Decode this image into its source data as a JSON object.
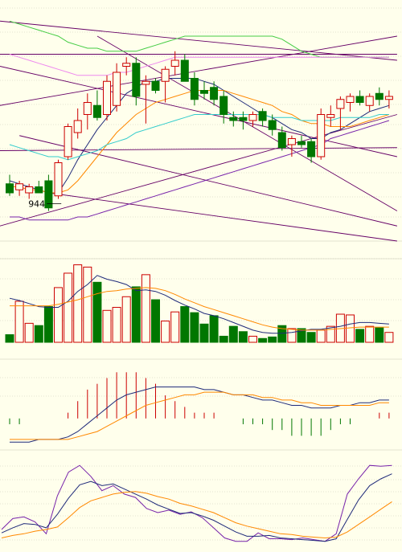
{
  "colors": {
    "background": "#ffffec",
    "grid": "#c8c8b4",
    "up": "#cc0000",
    "down": "#007700",
    "ma_short": "#1f2a7a",
    "ma_mid": "#ff8800",
    "ma_long": "#33cccc",
    "ma_xlong": "#7722aa",
    "boll_upper": "#44cc44",
    "pink": "#ee88ee",
    "channel": "#660066"
  },
  "chart_data": [
    {
      "type": "candlestick",
      "panel": "price",
      "annotation": {
        "text": "944",
        "bar_index": 2
      },
      "ylim": [
        930,
        1010
      ],
      "x": [
        0,
        1,
        2,
        3,
        4,
        5,
        6,
        7,
        8,
        9,
        10,
        11,
        12,
        13,
        14,
        15,
        16,
        17,
        18,
        19,
        20,
        21,
        22,
        23,
        24,
        25,
        26,
        27,
        28,
        29,
        30,
        31,
        32,
        33,
        34,
        35,
        36,
        37,
        38,
        39
      ],
      "candles": [
        {
          "o": 949,
          "h": 952,
          "l": 945,
          "c": 946
        },
        {
          "o": 947,
          "h": 950,
          "l": 945,
          "c": 949
        },
        {
          "o": 946,
          "h": 949,
          "l": 944,
          "c": 948
        },
        {
          "o": 948,
          "h": 950,
          "l": 946,
          "c": 946
        },
        {
          "o": 950,
          "h": 952,
          "l": 940,
          "c": 941
        },
        {
          "o": 945,
          "h": 957,
          "l": 944,
          "c": 956
        },
        {
          "o": 958,
          "h": 969,
          "l": 957,
          "c": 968
        },
        {
          "o": 966,
          "h": 974,
          "l": 964,
          "c": 970
        },
        {
          "o": 972,
          "h": 979,
          "l": 967,
          "c": 976
        },
        {
          "o": 975,
          "h": 980,
          "l": 970,
          "c": 971
        },
        {
          "o": 972,
          "h": 985,
          "l": 970,
          "c": 983
        },
        {
          "o": 975,
          "h": 989,
          "l": 973,
          "c": 986
        },
        {
          "o": 988,
          "h": 991,
          "l": 985,
          "c": 989
        },
        {
          "o": 989,
          "h": 991,
          "l": 975,
          "c": 978
        },
        {
          "o": 982,
          "h": 985,
          "l": 969,
          "c": 983
        },
        {
          "o": 983,
          "h": 984,
          "l": 979,
          "c": 980
        },
        {
          "o": 983,
          "h": 988,
          "l": 976,
          "c": 987
        },
        {
          "o": 988,
          "h": 993,
          "l": 985,
          "c": 990
        },
        {
          "o": 990,
          "h": 992,
          "l": 984,
          "c": 983
        },
        {
          "o": 984,
          "h": 986,
          "l": 975,
          "c": 977
        },
        {
          "o": 980,
          "h": 983,
          "l": 977,
          "c": 979
        },
        {
          "o": 981,
          "h": 983,
          "l": 975,
          "c": 977
        },
        {
          "o": 978,
          "h": 980,
          "l": 969,
          "c": 972
        },
        {
          "o": 971,
          "h": 973,
          "l": 968,
          "c": 970
        },
        {
          "o": 971,
          "h": 973,
          "l": 967,
          "c": 970
        },
        {
          "o": 970,
          "h": 973,
          "l": 968,
          "c": 972
        },
        {
          "o": 973,
          "h": 974,
          "l": 968,
          "c": 970
        },
        {
          "o": 970,
          "h": 972,
          "l": 965,
          "c": 967
        },
        {
          "o": 966,
          "h": 968,
          "l": 960,
          "c": 961
        },
        {
          "o": 962,
          "h": 965,
          "l": 958,
          "c": 964
        },
        {
          "o": 963,
          "h": 965,
          "l": 961,
          "c": 962
        },
        {
          "o": 963,
          "h": 964,
          "l": 956,
          "c": 958
        },
        {
          "o": 958,
          "h": 974,
          "l": 957,
          "c": 972
        },
        {
          "o": 971,
          "h": 975,
          "l": 968,
          "c": 972
        },
        {
          "o": 974,
          "h": 978,
          "l": 967,
          "c": 977
        },
        {
          "o": 976,
          "h": 979,
          "l": 973,
          "c": 978
        },
        {
          "o": 978,
          "h": 980,
          "l": 975,
          "c": 976
        },
        {
          "o": 975,
          "h": 979,
          "l": 973,
          "c": 978
        },
        {
          "o": 979,
          "h": 981,
          "l": 975,
          "c": 977
        },
        {
          "o": 977,
          "h": 980,
          "l": 974,
          "c": 978
        }
      ],
      "series": [
        {
          "values": [
            950,
            949,
            948,
            947,
            946,
            946,
            951,
            957,
            962,
            967,
            971,
            975,
            979,
            981,
            983,
            983,
            984,
            984,
            984,
            984,
            983,
            982,
            980,
            978,
            976,
            974,
            972,
            971,
            969,
            967,
            966,
            964,
            964,
            966,
            967,
            969,
            971,
            973,
            974,
            975
          ]
        },
        {
          "values": [
            948,
            948,
            947,
            947,
            946,
            946,
            947,
            950,
            954,
            958,
            962,
            966,
            969,
            972,
            974,
            976,
            977,
            978,
            979,
            980,
            980,
            980,
            980,
            979,
            978,
            977,
            976,
            975,
            973,
            972,
            970,
            969,
            969,
            968,
            968,
            968,
            969,
            970,
            971,
            972
          ]
        },
        {
          "values": [
            962,
            961,
            960,
            959,
            958,
            958,
            957,
            958,
            959,
            960,
            962,
            963,
            964,
            966,
            967,
            968,
            969,
            970,
            971,
            972,
            972,
            972,
            972,
            972,
            972,
            972,
            972,
            971,
            971,
            971,
            970,
            970,
            970,
            970,
            971,
            971,
            971,
            971,
            972,
            972
          ]
        },
        {
          "values": [
            938,
            938,
            937,
            937,
            937,
            937,
            937,
            938,
            938,
            939,
            940,
            941,
            942,
            943,
            944,
            945,
            946,
            947,
            948,
            949,
            950,
            951,
            952,
            953,
            954,
            955,
            956,
            957,
            958,
            959,
            960,
            961,
            962,
            964,
            965,
            966,
            967,
            968,
            969,
            970
          ]
        },
        {
          "values": [
            1003,
            1002,
            1001,
            1000,
            999,
            998,
            996,
            995,
            994,
            994,
            993,
            993,
            993,
            993,
            994,
            995,
            996,
            997,
            998,
            998,
            998,
            998,
            998,
            998,
            998,
            998,
            998,
            998,
            997,
            995,
            993,
            992,
            991,
            991,
            991,
            991,
            991,
            991,
            991,
            991
          ]
        },
        {
          "values": [
            992,
            991,
            990,
            989,
            988,
            987,
            986,
            985,
            985,
            985,
            985,
            986,
            986,
            987,
            988,
            989,
            990,
            991,
            991,
            991,
            991,
            991,
            991,
            991,
            991,
            991,
            991,
            991,
            991,
            991,
            991,
            991,
            991,
            991,
            991,
            991,
            991,
            991,
            991,
            991
          ]
        }
      ]
    },
    {
      "type": "bar",
      "panel": "volume",
      "x": [
        0,
        1,
        2,
        3,
        4,
        5,
        6,
        7,
        8,
        9,
        10,
        11,
        12,
        13,
        14,
        15,
        16,
        17,
        18,
        19,
        20,
        21,
        22,
        23,
        24,
        25,
        26,
        27,
        28,
        29,
        30,
        31,
        32,
        33,
        34,
        35,
        36,
        37,
        38,
        39
      ],
      "values": [
        10,
        54,
        25,
        22,
        47,
        72,
        91,
        102,
        99,
        79,
        42,
        46,
        60,
        73,
        89,
        56,
        28,
        40,
        47,
        39,
        24,
        35,
        8,
        21,
        14,
        8,
        5,
        7,
        22,
        18,
        18,
        13,
        16,
        21,
        37,
        36,
        17,
        21,
        19,
        13
      ],
      "series": [
        {
          "values": [
            58,
            55,
            51,
            47,
            46,
            46,
            54,
            67,
            76,
            88,
            83,
            80,
            76,
            68,
            69,
            67,
            62,
            55,
            49,
            44,
            38,
            35,
            31,
            26,
            21,
            16,
            13,
            12,
            12,
            13,
            15,
            17,
            17,
            19,
            21,
            24,
            26,
            26,
            25,
            24
          ]
        },
        {
          "values": [
            48,
            48,
            48,
            48,
            48,
            50,
            53,
            56,
            60,
            64,
            67,
            68,
            70,
            71,
            72,
            71,
            68,
            63,
            57,
            52,
            47,
            43,
            39,
            35,
            31,
            27,
            23,
            20,
            18,
            17,
            16,
            16,
            16,
            17,
            18,
            19,
            20,
            20,
            20,
            20
          ]
        }
      ],
      "ylim": [
        0,
        110
      ]
    },
    {
      "type": "bar",
      "panel": "macd",
      "x": [
        0,
        1,
        2,
        3,
        4,
        5,
        6,
        7,
        8,
        9,
        10,
        11,
        12,
        13,
        14,
        15,
        16,
        17,
        18,
        19,
        20,
        21,
        22,
        23,
        24,
        25,
        26,
        27,
        28,
        29,
        30,
        31,
        32,
        33,
        34,
        35,
        36,
        37,
        38,
        39
      ],
      "values": [
        -1,
        -1,
        0,
        0,
        0,
        0,
        1,
        3,
        5,
        6,
        7,
        8,
        8,
        8,
        7,
        6,
        4,
        3,
        2,
        1,
        1,
        1,
        0,
        0,
        -1,
        -1,
        -1,
        -2,
        -2,
        -3,
        -3,
        -3,
        -3,
        -2,
        -1,
        -1,
        0,
        0,
        1,
        1
      ],
      "series": [
        {
          "values": [
            -9,
            -9,
            -9,
            -8,
            -8,
            -8,
            -7,
            -5,
            -2,
            1,
            4,
            7,
            9,
            10,
            11,
            12,
            12,
            12,
            12,
            12,
            11,
            11,
            10,
            9,
            9,
            8,
            7,
            7,
            6,
            5,
            5,
            4,
            4,
            4,
            5,
            5,
            6,
            6,
            7,
            7
          ]
        },
        {
          "values": [
            -8,
            -8,
            -8,
            -8,
            -8,
            -8,
            -8,
            -7,
            -6,
            -5,
            -3,
            -1,
            1,
            3,
            5,
            6,
            7,
            8,
            9,
            9,
            10,
            10,
            10,
            9,
            9,
            9,
            8,
            8,
            7,
            7,
            6,
            6,
            5,
            5,
            5,
            5,
            5,
            5,
            6,
            6
          ]
        }
      ],
      "ylim": [
        -12,
        18
      ]
    },
    {
      "type": "line",
      "panel": "kdj",
      "x": [
        0,
        1,
        2,
        3,
        4,
        5,
        6,
        7,
        8,
        9,
        10,
        11,
        12,
        13,
        14,
        15,
        16,
        17,
        18,
        19,
        20,
        21,
        22,
        23,
        24,
        25,
        26,
        27,
        28,
        29,
        30,
        31,
        32,
        33,
        34,
        35,
        36,
        37,
        38,
        39
      ],
      "series": [
        {
          "values": [
            20,
            33,
            35,
            29,
            15,
            60,
            88,
            96,
            83,
            66,
            72,
            62,
            58,
            45,
            40,
            43,
            38,
            41,
            34,
            22,
            10,
            6,
            6,
            16,
            9,
            9,
            8,
            10,
            8,
            6,
            15,
            62,
            80,
            96,
            95,
            96
          ]
        },
        {
          "values": [
            16,
            22,
            27,
            26,
            22,
            38,
            57,
            73,
            77,
            72,
            74,
            68,
            62,
            56,
            49,
            44,
            39,
            40,
            36,
            31,
            24,
            17,
            12,
            12,
            13,
            10,
            9,
            8,
            7,
            6,
            9,
            32,
            55,
            72,
            80,
            86
          ]
        },
        {
          "values": [
            10,
            13,
            15,
            18,
            20,
            23,
            34,
            46,
            54,
            58,
            62,
            64,
            65,
            63,
            59,
            56,
            51,
            48,
            44,
            40,
            34,
            28,
            24,
            21,
            18,
            15,
            14,
            12,
            11,
            10,
            11,
            17,
            26,
            35,
            44,
            53
          ]
        }
      ],
      "ylim": [
        0,
        100
      ]
    }
  ]
}
